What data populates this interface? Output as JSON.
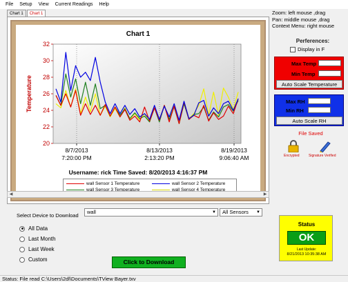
{
  "menu": [
    "File",
    "Setup",
    "View",
    "Current Readings",
    "Help"
  ],
  "tabs": [
    "Chart 1",
    "Chart 1"
  ],
  "hints": [
    "Zoom: left mouse ,drag",
    "Pan: middle mouse ,drag",
    "Context Menu: right mouse"
  ],
  "prefs": {
    "title": "Perferences:",
    "display_f": "Display in F"
  },
  "temp_box": {
    "max_label": "Max Temp",
    "min_label": "Min Temp",
    "button": "Auto Scale Temperature",
    "color": "#f00000"
  },
  "rh_box": {
    "max_label": "Max RH",
    "min_label": "Min RH",
    "button": "Auto Scale RH",
    "color": "#1030e8"
  },
  "file_saved": "File Saved",
  "icons": {
    "encrypted_label": "Encrypted",
    "verified_label": "Signature Verified"
  },
  "chart": {
    "title": "Chart 1",
    "ylabel": "Temperature",
    "user_line": "Username: rick  Time Saved: 8/20/2013 4:16:37 PM",
    "yticks": [
      "32",
      "30",
      "28",
      "26",
      "24",
      "22",
      "20"
    ],
    "xticks": [
      {
        "date": "8/7/2013",
        "time": "7:20:00 PM"
      },
      {
        "date": "8/13/2013",
        "time": "2:13:20 PM"
      },
      {
        "date": "8/19/2013",
        "time": "9:06:40 AM"
      }
    ],
    "legend": [
      {
        "name": "wall Sensor 1 Temperature",
        "color": "#e00000"
      },
      {
        "name": "wall Sensor 2 Temperature",
        "color": "#0000e0"
      },
      {
        "name": "wall Sensor 3 Temperature",
        "color": "#208020"
      },
      {
        "name": "wall Sensor 4 Temperature",
        "color": "#f0f000"
      }
    ]
  },
  "chart_data": {
    "type": "line",
    "title": "Chart 1",
    "ylabel": "Temperature",
    "ylim": [
      20,
      32
    ],
    "x_start": "8/5/2013",
    "x_ticks": [
      "8/7/2013 7:20:00 PM",
      "8/13/2013 2:13:20 PM",
      "8/19/2013 9:06:40 AM"
    ],
    "grid": "vertical dashed",
    "legend_position": "bottom",
    "series": [
      {
        "name": "wall Sensor 1 Temperature",
        "color": "#e00000",
        "values": [
          25.8,
          24.6,
          26.0,
          24.4,
          26.4,
          23.4,
          24.8,
          23.5,
          24.6,
          23.4,
          24.7,
          23.3,
          24.4,
          23.2,
          24.1,
          22.8,
          23.3,
          22.6,
          24.4,
          22.7,
          24.3,
          22.8,
          24.6,
          22.6,
          24.5,
          22.4,
          25.0,
          22.9,
          23.4,
          23.1,
          24.6,
          22.7,
          23.7,
          22.9,
          23.3,
          24.5,
          23.6,
          25.4
        ]
      },
      {
        "name": "wall Sensor 2 Temperature",
        "color": "#0000e0",
        "values": [
          26.6,
          25.0,
          31.0,
          26.4,
          29.4,
          28.0,
          28.6,
          27.6,
          30.4,
          27.4,
          25.0,
          23.6,
          24.8,
          23.6,
          24.6,
          23.5,
          24.2,
          23.2,
          23.6,
          22.9,
          24.6,
          22.9,
          24.5,
          23.2,
          24.8,
          22.8,
          25.1,
          23.0,
          23.4,
          24.9,
          25.2,
          23.3,
          24.3,
          23.6,
          24.8,
          25.1,
          24.0,
          25.4
        ]
      },
      {
        "name": "wall Sensor 3 Temperature",
        "color": "#208020",
        "values": [
          25.8,
          24.6,
          28.4,
          25.6,
          27.8,
          24.8,
          27.4,
          24.6,
          27.2,
          24.2,
          24.6,
          23.3,
          24.4,
          23.4,
          24.2,
          23.0,
          23.7,
          23.0,
          23.3,
          22.6,
          24.3,
          22.6,
          24.6,
          22.9,
          24.4,
          22.4,
          24.8,
          22.9,
          23.5,
          23.6,
          24.4,
          22.8,
          23.8,
          23.2,
          24.4,
          24.7,
          23.9,
          25.2
        ]
      },
      {
        "name": "wall Sensor 4 Temperature",
        "color": "#f0f000",
        "values": [
          24.8,
          24.3,
          26.4,
          24.4,
          26.6,
          23.6,
          25.6,
          23.8,
          26.0,
          23.4,
          24.5,
          23.2,
          24.2,
          23.2,
          24.3,
          22.9,
          23.6,
          22.8,
          23.6,
          22.6,
          24.3,
          22.7,
          24.6,
          22.8,
          24.6,
          22.4,
          24.9,
          23.0,
          23.6,
          24.6,
          26.6,
          23.4,
          26.2,
          23.4,
          26.7,
          25.6,
          24.1,
          26.2
        ]
      }
    ]
  },
  "download": {
    "select_label": "Select Device to Download",
    "device": "wall",
    "sensors": "All Sensors",
    "radios": [
      {
        "label": "All Data",
        "selected": true
      },
      {
        "label": "Last Month",
        "selected": false
      },
      {
        "label": "Last Week",
        "selected": false
      },
      {
        "label": "Custom",
        "selected": false
      }
    ],
    "button": "Click to Download"
  },
  "status_box": {
    "title": "Status",
    "ok": "OK",
    "last_update_label": "Last Update:",
    "last_update": "8/21/2013 10:35:38 AM"
  },
  "statusbar": "Status:  File read C:\\Users\\2dl\\Documents\\TView Bayer.txv"
}
